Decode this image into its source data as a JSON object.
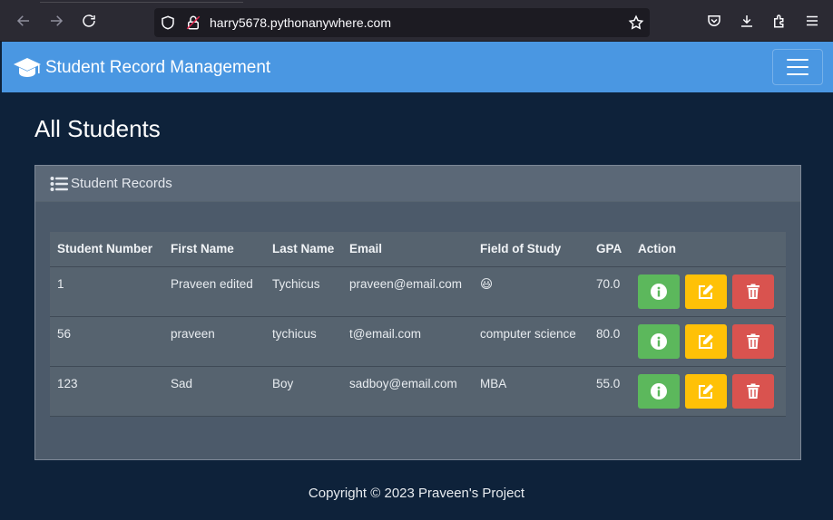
{
  "browser": {
    "url": "harry5678.pythonanywhere.com"
  },
  "navbar": {
    "brand": "Student Record Management"
  },
  "page": {
    "title": "All Students"
  },
  "card": {
    "header": "Student Records"
  },
  "table": {
    "columns": [
      "Student Number",
      "First Name",
      "Last Name",
      "Email",
      "Field of Study",
      "GPA",
      "Action"
    ],
    "rows": [
      {
        "number": "1",
        "first": "Praveen edited",
        "last": "Tychicus",
        "email": "praveen@email.com",
        "field": "😃",
        "gpa": "70.0"
      },
      {
        "number": "56",
        "first": "praveen",
        "last": "tychicus",
        "email": "t@email.com",
        "field": "computer science",
        "gpa": "80.0"
      },
      {
        "number": "123",
        "first": "Sad",
        "last": "Boy",
        "email": "sadboy@email.com",
        "field": "MBA",
        "gpa": "55.0"
      }
    ]
  },
  "footer": {
    "text": "Copyright © 2023 Praveen's Project"
  },
  "colors": {
    "navbar": "#4a97e2",
    "page_bg": "#0e223a",
    "info": "#5cb85c",
    "edit": "#ffc107",
    "delete": "#d9534f"
  }
}
